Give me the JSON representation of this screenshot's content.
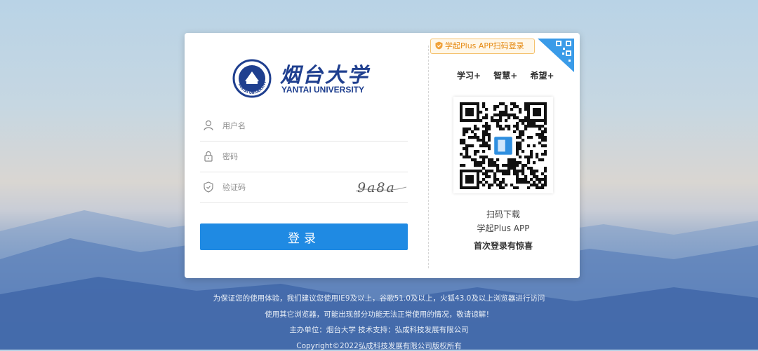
{
  "school": {
    "name_cn": "烟台大学",
    "name_en": "YANTAI UNIVERSITY",
    "seal_text": "YANTAI UNIVERSITY"
  },
  "form": {
    "username_placeholder": "用户名",
    "password_placeholder": "密码",
    "captcha_placeholder": "验证码",
    "captcha_text": "9a8a",
    "login_label": "登录"
  },
  "app": {
    "tag": "学起Plus APP扫码登录",
    "slogans": [
      "学习+",
      "智慧+",
      "希望+"
    ],
    "scan_line1": "扫码下载",
    "scan_line2": "学起Plus APP",
    "first_login": "首次登录有惊喜"
  },
  "footer": {
    "line1": "为保证您的使用体验，我们建议您使用IE9及以上，谷歌51.0及以上，火狐43.0及以上浏览器进行访问",
    "line2": "使用其它浏览器，可能出现部分功能无法正常使用的情况，敬请谅解！",
    "line3": "主办单位：烟台大学  技术支持：弘成科技发展有限公司",
    "line4": "Copyright©2022弘成科技发展有限公司版权所有"
  },
  "colors": {
    "primary": "#1f8ae3",
    "accent": "#e58a12",
    "brand": "#1f3f8f"
  },
  "icons": [
    "user-icon",
    "lock-icon",
    "shield-icon",
    "qr-code-icon"
  ]
}
